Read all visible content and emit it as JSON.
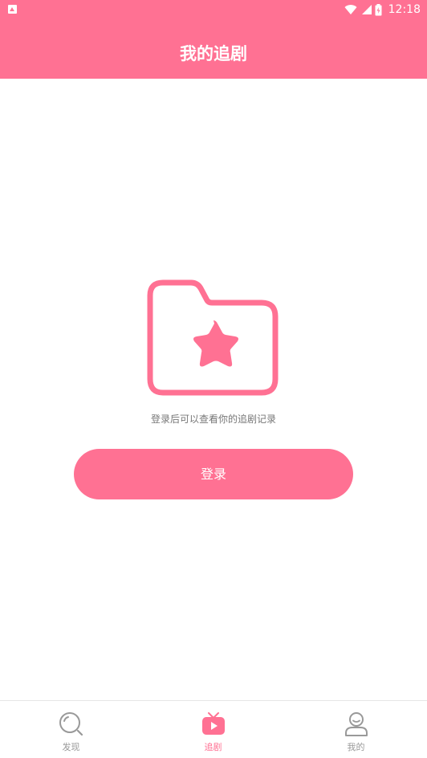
{
  "status_bar": {
    "time": "12:18"
  },
  "header": {
    "title": "我的追剧"
  },
  "empty_state": {
    "icon": "folder-star-icon",
    "message": "登录后可以查看你的追剧记录"
  },
  "login_button": {
    "label": "登录"
  },
  "bottom_nav": {
    "items": [
      {
        "label": "发现",
        "icon": "search-icon",
        "active": false
      },
      {
        "label": "追剧",
        "icon": "tv-play-icon",
        "active": true
      },
      {
        "label": "我的",
        "icon": "user-icon",
        "active": false
      }
    ]
  },
  "colors": {
    "accent": "#ff7193",
    "nav_inactive": "#999999",
    "message_text": "#777777"
  }
}
